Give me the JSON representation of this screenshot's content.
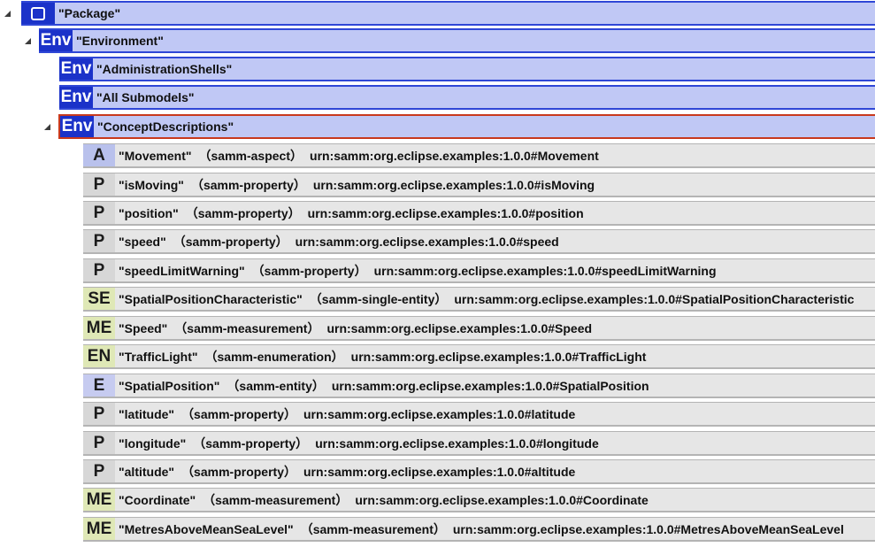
{
  "colors": {
    "environment_fill": "#c0c8f5",
    "environment_border": "#2f47d6",
    "environment_badge": "#1b32c9",
    "selected_border": "#c8391e",
    "concept_row_fill": "#e6e6e6",
    "badge_aspect": "#b9c1ec",
    "badge_entity": "#c6cbf0",
    "badge_property": "#d7d7d7",
    "badge_characteristic": "#dfe8b6"
  },
  "tree": {
    "package": {
      "icon": "package-square-icon",
      "label": "\"Package\""
    },
    "environment": {
      "badge": "Env",
      "label": "\"Environment\""
    },
    "administration_shells": {
      "badge": "Env",
      "label": "\"AdministrationShells\""
    },
    "all_submodels": {
      "badge": "Env",
      "label": "\"All Submodels\""
    },
    "concept_descriptions": {
      "badge": "Env",
      "label": "\"ConceptDescriptions\""
    },
    "items": [
      {
        "badge": "A",
        "name": "\"Movement\"",
        "kind": "（samm-aspect）",
        "urn": "urn:samm:org.eclipse.examples:1.0.0#Movement"
      },
      {
        "badge": "P",
        "name": "\"isMoving\"",
        "kind": "（samm-property）",
        "urn": "urn:samm:org.eclipse.examples:1.0.0#isMoving"
      },
      {
        "badge": "P",
        "name": "\"position\"",
        "kind": "（samm-property）",
        "urn": "urn:samm:org.eclipse.examples:1.0.0#position"
      },
      {
        "badge": "P",
        "name": "\"speed\"",
        "kind": "（samm-property）",
        "urn": "urn:samm:org.eclipse.examples:1.0.0#speed"
      },
      {
        "badge": "P",
        "name": "\"speedLimitWarning\"",
        "kind": "（samm-property）",
        "urn": "urn:samm:org.eclipse.examples:1.0.0#speedLimitWarning"
      },
      {
        "badge": "SE",
        "name": "\"SpatialPositionCharacteristic\"",
        "kind": "（samm-single-entity）",
        "urn": "urn:samm:org.eclipse.examples:1.0.0#SpatialPositionCharacteristic"
      },
      {
        "badge": "ME",
        "name": "\"Speed\"",
        "kind": "（samm-measurement）",
        "urn": "urn:samm:org.eclipse.examples:1.0.0#Speed"
      },
      {
        "badge": "EN",
        "name": "\"TrafficLight\"",
        "kind": "（samm-enumeration）",
        "urn": "urn:samm:org.eclipse.examples:1.0.0#TrafficLight"
      },
      {
        "badge": "E",
        "name": "\"SpatialPosition\"",
        "kind": "（samm-entity）",
        "urn": "urn:samm:org.eclipse.examples:1.0.0#SpatialPosition"
      },
      {
        "badge": "P",
        "name": "\"latitude\"",
        "kind": "（samm-property）",
        "urn": "urn:samm:org.eclipse.examples:1.0.0#latitude"
      },
      {
        "badge": "P",
        "name": "\"longitude\"",
        "kind": "（samm-property）",
        "urn": "urn:samm:org.eclipse.examples:1.0.0#longitude"
      },
      {
        "badge": "P",
        "name": "\"altitude\"",
        "kind": "（samm-property）",
        "urn": "urn:samm:org.eclipse.examples:1.0.0#altitude"
      },
      {
        "badge": "ME",
        "name": "\"Coordinate\"",
        "kind": "（samm-measurement）",
        "urn": "urn:samm:org.eclipse.examples:1.0.0#Coordinate"
      },
      {
        "badge": "ME",
        "name": "\"MetresAboveMeanSeaLevel\"",
        "kind": "（samm-measurement）",
        "urn": "urn:samm:org.eclipse.examples:1.0.0#MetresAboveMeanSeaLevel"
      }
    ]
  }
}
